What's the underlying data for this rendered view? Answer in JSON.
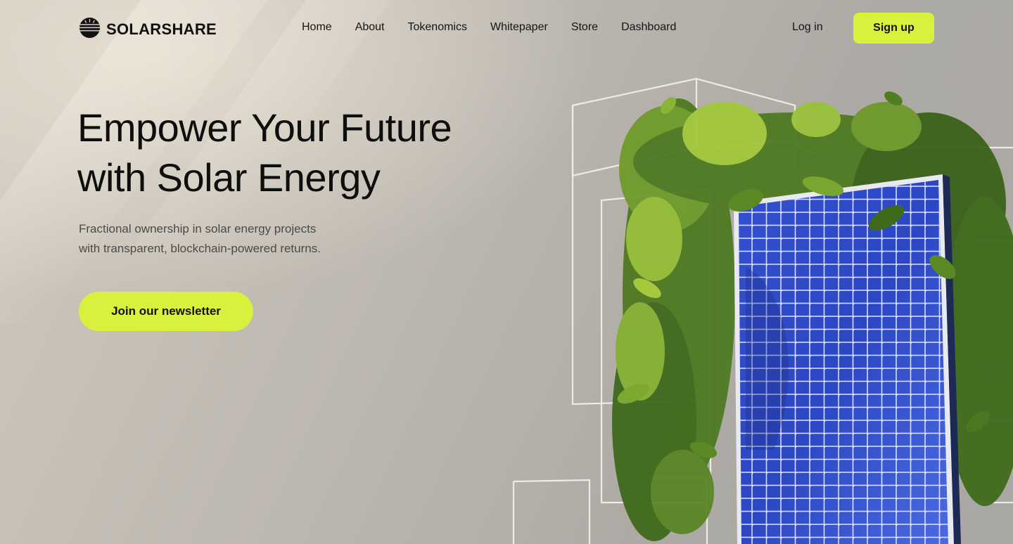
{
  "brand": {
    "name": "SOLARSHARE",
    "logo_icon": "sunrise-icon"
  },
  "nav": {
    "links": [
      "Home",
      "About",
      "Tokenomics",
      "Whitepaper",
      "Store",
      "Dashboard"
    ],
    "login_label": "Log in",
    "signup_label": "Sign up"
  },
  "hero": {
    "title_line1": "Empower Your Future",
    "title_line2": "with Solar Energy",
    "subtitle_line1": "Fractional ownership in solar energy projects",
    "subtitle_line2": "with transparent, blockchain-powered returns.",
    "cta_label": "Join our newsletter"
  },
  "colors": {
    "accent": "#d9f03c",
    "panel_blue": "#2f4fc9",
    "foliage": "#5d8a2a"
  }
}
